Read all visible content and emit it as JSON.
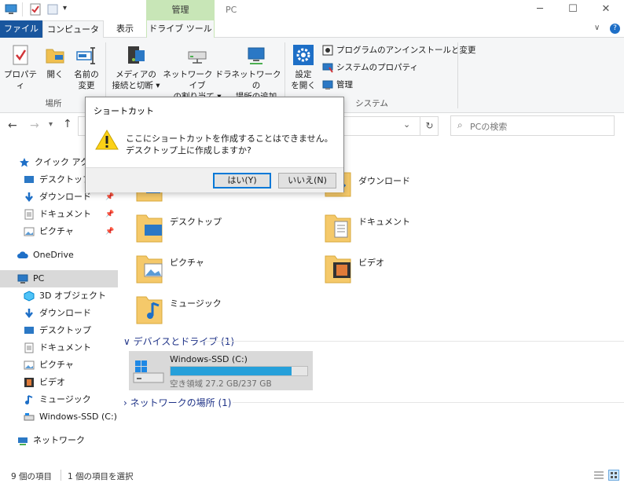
{
  "window": {
    "title": "PC",
    "contextual_tab": "管理",
    "controls": [
      "─",
      "☐",
      "✕"
    ]
  },
  "tabs": {
    "file": "ファイル",
    "computer": "コンピューター",
    "view": "表示",
    "drive_tools": "ドライブ ツール"
  },
  "ribbon": {
    "properties": "プロパティ",
    "open": "開く",
    "rename": [
      "名前の",
      "変更"
    ],
    "media": [
      "メディアの",
      "接続と切断 ▾"
    ],
    "map_drive": [
      "ネットワーク ドライブ",
      "の割り当て ▾"
    ],
    "add_location": [
      "ネットワークの",
      "場所の追加"
    ],
    "settings": [
      "設定",
      "を開く"
    ],
    "uninstall": "プログラムのアンインストールと変更",
    "sys_props": "システムのプロパティ",
    "manage": "管理",
    "group_location": "場所",
    "group_system": "システム"
  },
  "search": {
    "placeholder": "PCの検索"
  },
  "nav": {
    "quick_access": "クイック アクセス",
    "quick_items": [
      "デスクトップ",
      "ダウンロード",
      "ドキュメント",
      "ピクチャ"
    ],
    "onedrive": "OneDrive",
    "pc": "PC",
    "pc_items": [
      "3D オブジェクト",
      "ダウンロード",
      "デスクトップ",
      "ドキュメント",
      "ピクチャ",
      "ビデオ",
      "ミュージック",
      "Windows-SSD (C:)"
    ],
    "network": "ネットワーク"
  },
  "content": {
    "folders": [
      "ダウンロード",
      "デスクトップ",
      "ドキュメント",
      "ピクチャ",
      "ビデオ",
      "ミュージック"
    ],
    "devices_header": "デバイスとドライブ (1)",
    "drive_name": "Windows-SSD (C:)",
    "drive_space": "空き領域 27.2 GB/237 GB",
    "drive_used_fraction": 0.885,
    "network_header": "ネットワークの場所 (1)"
  },
  "dialog": {
    "title": "ショートカット",
    "message_line1": "ここにショートカットを作成することはできません。",
    "message_line2": "デスクトップ上に作成しますか?",
    "yes": "はい(Y)",
    "no": "いいえ(N)"
  },
  "status": {
    "items": "9 個の項目",
    "selected": "1 個の項目を選択"
  },
  "colors": {
    "accent": "#19569e",
    "drive_bar": "#26a0da",
    "tools_tab": "#c8e6b7",
    "selection": "#cce8ff"
  }
}
